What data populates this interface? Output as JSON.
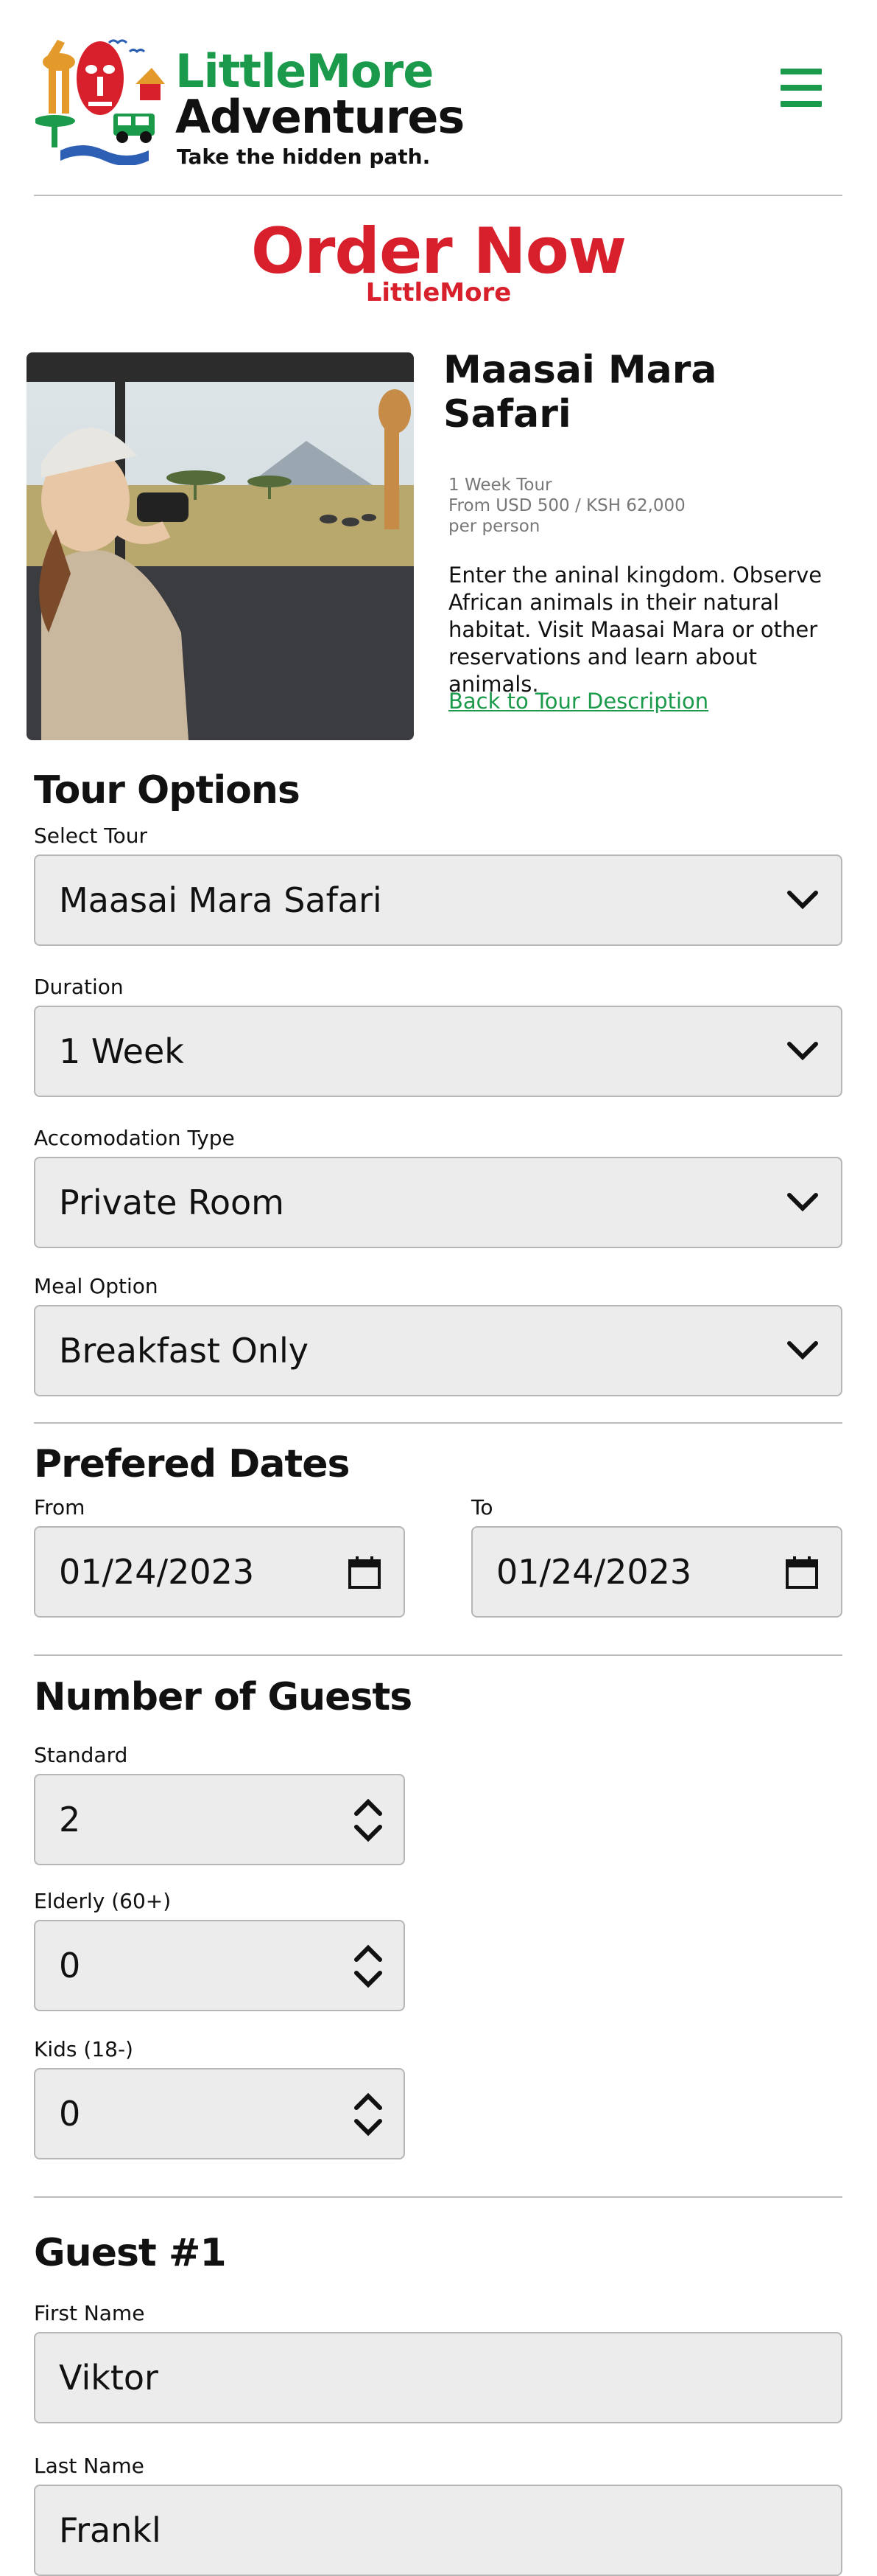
{
  "header": {
    "brand_line1": "LittleMore",
    "brand_line2": "Adventures",
    "tagline": "Take the hidden path."
  },
  "order": {
    "title": "Order Now",
    "subtitle": "LittleMore"
  },
  "tour": {
    "name_line1": "Maasai Mara",
    "name_line2": "Safari",
    "duration": "1 Week Tour",
    "price": "From USD 500 / KSH 62,000",
    "per": "per person",
    "description": "Enter the aninal kingdom. Observe African animals in their natural habitat. Visit Maasai Mara or other reservations and learn about animals.",
    "back_link": "Back to Tour Description"
  },
  "tour_options": {
    "title": "Tour Options",
    "select_tour_label": "Select Tour",
    "select_tour_value": "Maasai Mara Safari",
    "duration_label": "Duration",
    "duration_value": "1 Week",
    "accommodation_label": "Accomodation Type",
    "accommodation_value": "Private Room",
    "meal_label": "Meal Option",
    "meal_value": "Breakfast Only"
  },
  "dates": {
    "title": "Prefered Dates",
    "from_label": "From",
    "from_value": "01/24/2023",
    "to_label": "To",
    "to_value": "01/24/2023"
  },
  "guests": {
    "title": "Number of Guests",
    "standard_label": "Standard",
    "standard_value": "2",
    "elderly_label": "Elderly (60+)",
    "elderly_value": "0",
    "kids_label": "Kids (18-)",
    "kids_value": "0"
  },
  "guest1": {
    "title": "Guest #1",
    "first_name_label": "First Name",
    "first_name_value": "Viktor",
    "last_name_label": "Last Name",
    "last_name_value": "Frankl"
  },
  "colors": {
    "brand_green": "#1a9a4a",
    "brand_red": "#d7202c",
    "field_bg": "#ececec"
  }
}
